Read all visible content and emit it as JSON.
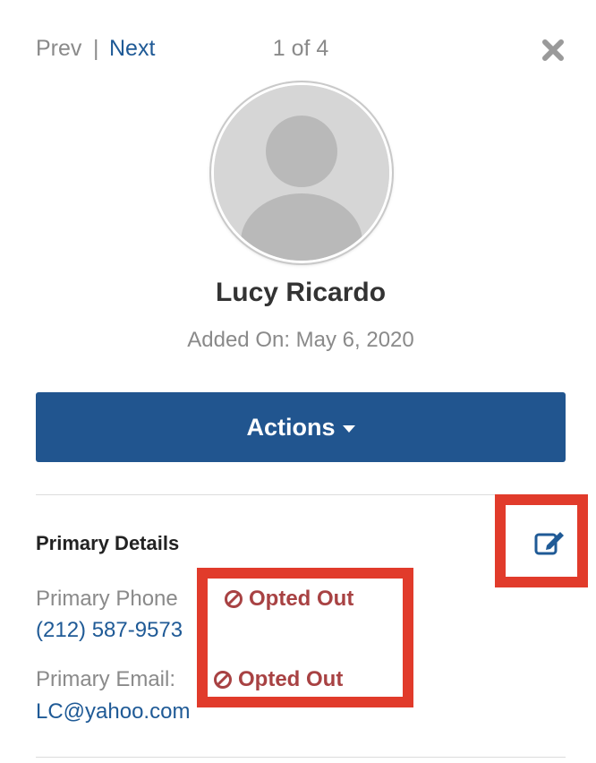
{
  "nav": {
    "prev_label": "Prev",
    "separator": "|",
    "next_label": "Next",
    "counter": "1 of 4"
  },
  "profile": {
    "name": "Lucy Ricardo",
    "added_on": "Added On: May 6, 2020"
  },
  "actions_button": {
    "label": "Actions"
  },
  "section": {
    "title": "Primary Details"
  },
  "fields": {
    "phone": {
      "label": "Primary Phone",
      "value": "(212) 587-9573",
      "status": "Opted Out"
    },
    "email": {
      "label": "Primary Email:",
      "value": "LC@yahoo.com",
      "status": "Opted Out"
    }
  },
  "colors": {
    "brand_blue": "#21558f",
    "link_blue": "#1f5a96",
    "highlight_red": "#e13b2b",
    "opted_out_red": "#a84243"
  },
  "icons": [
    "close-icon",
    "avatar-placeholder-icon",
    "caret-down-icon",
    "edit-icon",
    "prohibited-icon"
  ]
}
